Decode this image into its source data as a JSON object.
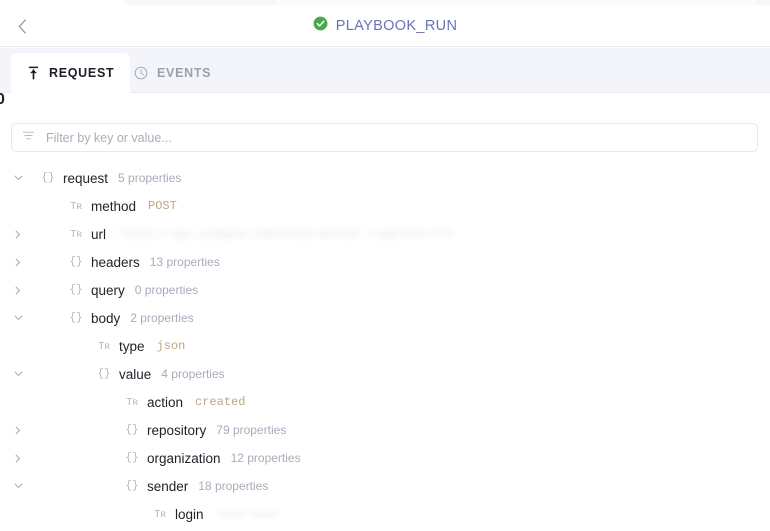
{
  "header": {
    "back_icon": "chevron-left-icon",
    "status_icon": "check-circle-icon",
    "status_color": "#49a84c",
    "title": "PLAYBOOK_RUN",
    "title_color": "#6b72b5"
  },
  "tabs": [
    {
      "label": "REQUEST",
      "icon": "upload-arrow-icon",
      "active": true
    },
    {
      "label": "EVENTS",
      "icon": "clock-icon",
      "active": false
    }
  ],
  "stray_glyph": "0",
  "filter": {
    "icon": "filter-icon",
    "placeholder": "Filter by key or value...",
    "value": ""
  },
  "tree": {
    "value_color": "#c0a57e",
    "rows": [
      {
        "key": "request",
        "indent": 0,
        "type_icon": "{}",
        "expander": "expanded",
        "meta": "5 properties",
        "value": ""
      },
      {
        "key": "method",
        "indent": 1,
        "type_icon": "Tr",
        "expander": "none",
        "meta": "",
        "value": "POST"
      },
      {
        "key": "url",
        "indent": 1,
        "type_icon": "Tr",
        "expander": "collapsed",
        "meta": "",
        "value": "",
        "redacted": "https://api.example.com/hooks/abc123   x-payload-7f3"
      },
      {
        "key": "headers",
        "indent": 1,
        "type_icon": "{}",
        "expander": "collapsed",
        "meta": "13 properties",
        "value": ""
      },
      {
        "key": "query",
        "indent": 1,
        "type_icon": "{}",
        "expander": "collapsed",
        "meta": "0 properties",
        "value": ""
      },
      {
        "key": "body",
        "indent": 1,
        "type_icon": "{}",
        "expander": "expanded",
        "meta": "2 properties",
        "value": ""
      },
      {
        "key": "type",
        "indent": 2,
        "type_icon": "Tr",
        "expander": "none",
        "meta": "",
        "value": "json"
      },
      {
        "key": "value",
        "indent": 2,
        "type_icon": "{}",
        "expander": "expanded",
        "meta": "4 properties",
        "value": ""
      },
      {
        "key": "action",
        "indent": 3,
        "type_icon": "Tr",
        "expander": "none",
        "meta": "",
        "value": "created"
      },
      {
        "key": "repository",
        "indent": 3,
        "type_icon": "{}",
        "expander": "collapsed",
        "meta": "79 properties",
        "value": ""
      },
      {
        "key": "organization",
        "indent": 3,
        "type_icon": "{}",
        "expander": "collapsed",
        "meta": "12 properties",
        "value": ""
      },
      {
        "key": "sender",
        "indent": 3,
        "type_icon": "{}",
        "expander": "expanded",
        "meta": "18 properties",
        "value": ""
      },
      {
        "key": "login",
        "indent": 4,
        "type_icon": "Tr",
        "expander": "none",
        "meta": "",
        "value": "",
        "redacted": "octo-user"
      }
    ]
  }
}
